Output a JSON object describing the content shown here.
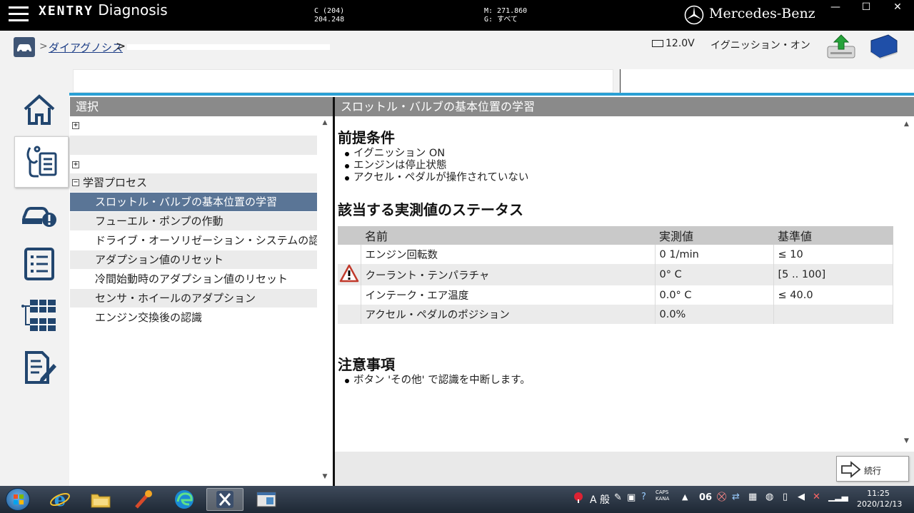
{
  "topbar": {
    "brand_xentry": "XENTRY",
    "brand_diagnosis": "Diagnosis",
    "code_c_line1": "C (204)",
    "code_c_line2": "204.248",
    "code_m_line1": "M: 271.860",
    "code_m_line2": "G: すべて",
    "make": "Mercedes-Benz",
    "min_glyph": "—",
    "max_glyph": "☐",
    "close_glyph": "✕"
  },
  "breadcrumb": {
    "link": "ダイアグノシス",
    "sep": ">",
    "voltage": "12.0V",
    "ignition": "イグニッション・オン"
  },
  "left_panel": {
    "header": "選択",
    "rows": [
      {
        "label": "",
        "expander": "+",
        "level": 0
      },
      {
        "label": "",
        "expander": "",
        "level": 0
      },
      {
        "label": "",
        "expander": "+",
        "level": 0
      },
      {
        "label": "学習プロセス",
        "expander": "−",
        "level": 0
      },
      {
        "label": "スロットル・バルブの基本位置の学習",
        "expander": "",
        "level": 1
      },
      {
        "label": "フューエル・ポンプの作動",
        "expander": "",
        "level": 1
      },
      {
        "label": "ドライブ・オーソリゼーション・システムの認識",
        "expander": "",
        "level": 1
      },
      {
        "label": "アダプション値のリセット",
        "expander": "",
        "level": 1
      },
      {
        "label": "冷間始動時のアダプション値のリセット",
        "expander": "",
        "level": 1
      },
      {
        "label": "センサ・ホイールのアダプション",
        "expander": "",
        "level": 1
      },
      {
        "label": "エンジン交換後の認識",
        "expander": "",
        "level": 1
      }
    ]
  },
  "right_panel": {
    "header": "スロットル・バルブの基本位置の学習",
    "prereq_title": "前提条件",
    "prereq_items": [
      "イグニッション ON",
      "エンジンは停止状態",
      "アクセル・ペダルが操作されていない"
    ],
    "status_title": "該当する実測値のステータス",
    "table": {
      "col_name": "名前",
      "col_actual": "実測値",
      "col_spec": "基準値",
      "rows": [
        {
          "name": "エンジン回転数",
          "actual": "0 1/min",
          "spec": "≤ 10",
          "state": "ok"
        },
        {
          "name": "クーラント・テンパラチャ",
          "actual": "0° C",
          "spec": "[5 .. 100]",
          "state": "bad"
        },
        {
          "name": "インテーク・エア温度",
          "actual": "0.0° C",
          "spec": "≤ 40.0",
          "state": "ok"
        },
        {
          "name": "アクセル・ペダルのポジション",
          "actual": "0.0%",
          "spec": "",
          "state": "neutral"
        }
      ]
    },
    "notes_title": "注意事項",
    "notes_items": [
      "ボタン 'その他' で認識を中断します。"
    ],
    "continue_label": "続行"
  },
  "taskbar": {
    "ime_mode": "A 般",
    "caps": "CAPS",
    "kana": "KANA",
    "tray_num": "06",
    "time": "11:25",
    "date": "2020/12/13"
  }
}
